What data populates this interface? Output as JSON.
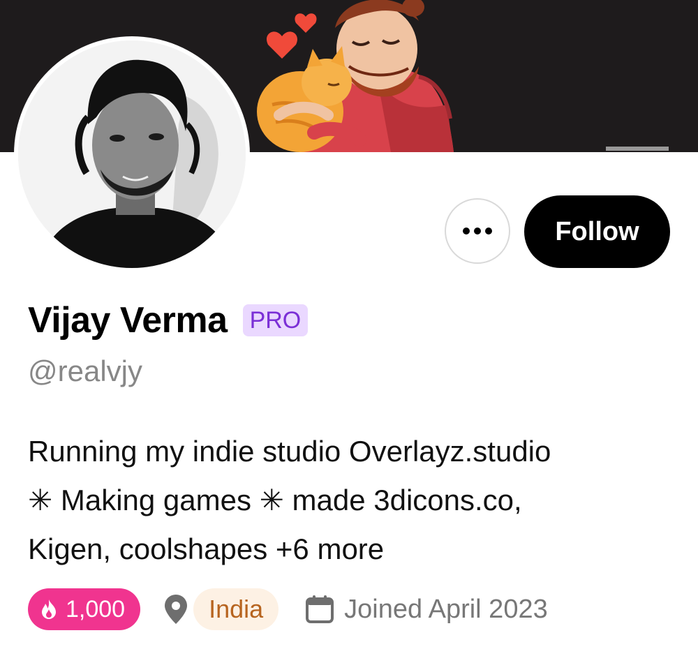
{
  "profile": {
    "name": "Vijay Verma",
    "badge": "PRO",
    "handle": "@realvjy",
    "bio_lines": [
      "Running my indie studio Overlayz.studio",
      "✳ Making games ✳ made 3dicons.co,",
      "Kigen, coolshapes +6 more"
    ]
  },
  "actions": {
    "more_label": "More options",
    "follow_label": "Follow"
  },
  "meta": {
    "streak_count": "1,000",
    "location": "India",
    "joined": "Joined April 2023"
  },
  "colors": {
    "banner_bg": "#1e1b1c",
    "pro_bg": "#ead8ff",
    "pro_text": "#7b2fd6",
    "streak_bg": "#f0348f",
    "location_bg": "#fdf1e4",
    "location_text": "#b7641f",
    "follow_bg": "#000000"
  },
  "icons": {
    "more": "ellipsis-icon",
    "streak": "flame-icon",
    "location": "map-pin-icon",
    "joined": "calendar-icon"
  }
}
